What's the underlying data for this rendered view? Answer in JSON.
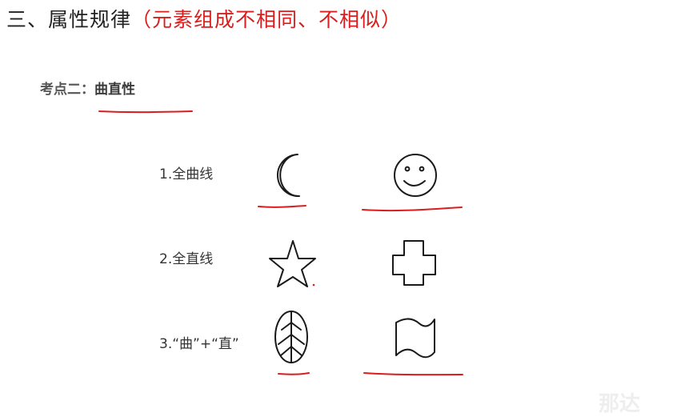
{
  "header": {
    "title": "三、属性规律",
    "title_note": "（元素组成不相同、不相似）",
    "note_color": "#d81e1e"
  },
  "section": {
    "label": "考点二：",
    "topic": "曲直性"
  },
  "rows": [
    {
      "label": "1.全曲线",
      "shapes": [
        "crescent-moon-icon",
        "smiley-face-icon"
      ]
    },
    {
      "label": "2.全直线",
      "shapes": [
        "star-icon",
        "cross-icon"
      ]
    },
    {
      "label": "3.“曲”+“直”",
      "shapes": [
        "leaf-icon",
        "flag-icon"
      ]
    }
  ],
  "watermark": "那达",
  "annotation_color": "#d81e1e"
}
